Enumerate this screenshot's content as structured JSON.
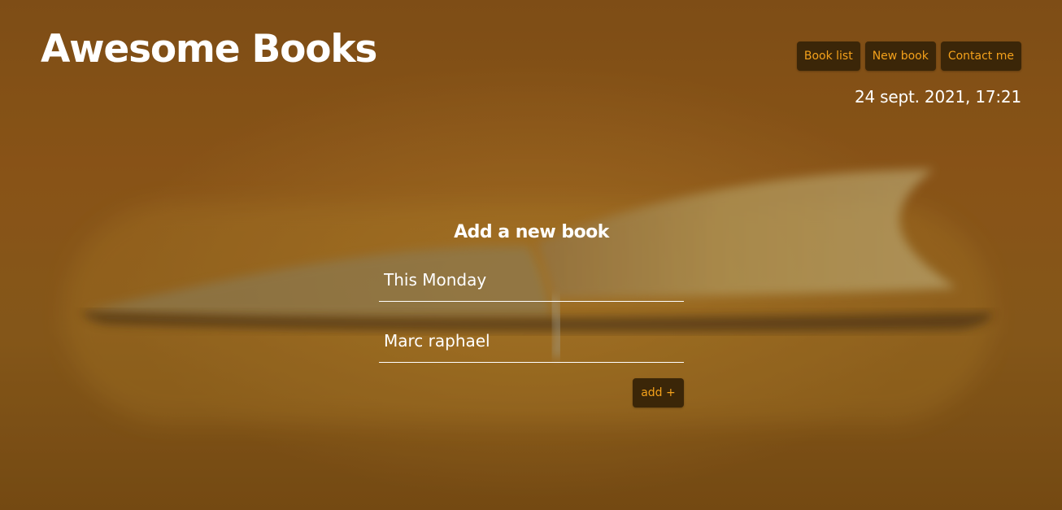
{
  "app": {
    "title": "Awesome Books"
  },
  "header": {
    "datetime": "24 sept. 2021, 17:21",
    "nav": [
      {
        "label": "Book list"
      },
      {
        "label": "New book"
      },
      {
        "label": "Contact me"
      }
    ]
  },
  "form": {
    "heading": "Add a new book",
    "title_value": "This Monday",
    "author_value": "Marc raphael",
    "add_label": "add +"
  },
  "colors": {
    "accent": "#f4a11b",
    "button_background": "#3b2608",
    "text": "#ffffff"
  }
}
